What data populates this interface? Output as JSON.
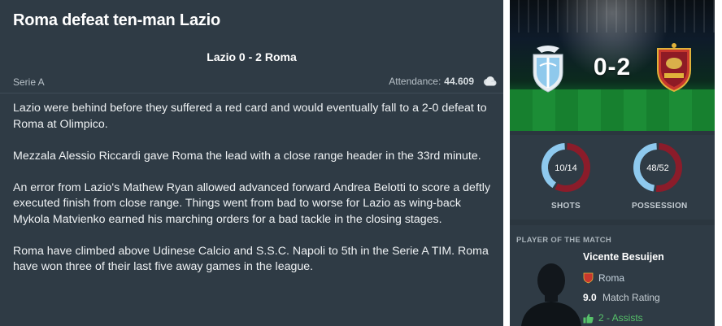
{
  "article": {
    "title": "Roma defeat ten-man Lazio",
    "scoreline": "Lazio 0 - 2 Roma",
    "competition": "Serie A",
    "attendance_label": "Attendance:",
    "attendance_value": "44.609",
    "weather_icon": "cloud-icon",
    "paragraphs": [
      "Lazio were behind before they suffered a red card and would eventually fall to a 2-0 defeat to Roma at Olimpico.",
      "Mezzala Alessio Riccardi gave Roma the lead with a close range header in the 33rd minute.",
      "An error from Lazio's Mathew Ryan allowed advanced forward Andrea Belotti to score a deftly executed finish from close range. Things went from bad to worse for Lazio as wing-back Mykola Matvienko earned his marching orders for a bad tackle in the closing stages.",
      "Roma have climbed above Udinese Calcio and S.S.C. Napoli to 5th in the Serie A TIM. Roma have won three of their last five away games in the league."
    ]
  },
  "banner": {
    "score": "0-2",
    "home_crest": "lazio-crest-icon",
    "away_crest": "roma-crest-icon"
  },
  "stats": {
    "shots": {
      "text": "10/14",
      "label": "SHOTS",
      "home": 10,
      "away": 14
    },
    "possession": {
      "text": "48/52",
      "label": "POSSESSION",
      "home": 48,
      "away": 52
    },
    "home_color": "#8ec9ee",
    "away_color": "#8b1c2a"
  },
  "potm": {
    "heading": "PLAYER OF THE MATCH",
    "name": "Vicente Besuijen",
    "team": "Roma",
    "rating_value": "9.0",
    "rating_label": "Match Rating",
    "assists": "2 - Assists"
  }
}
